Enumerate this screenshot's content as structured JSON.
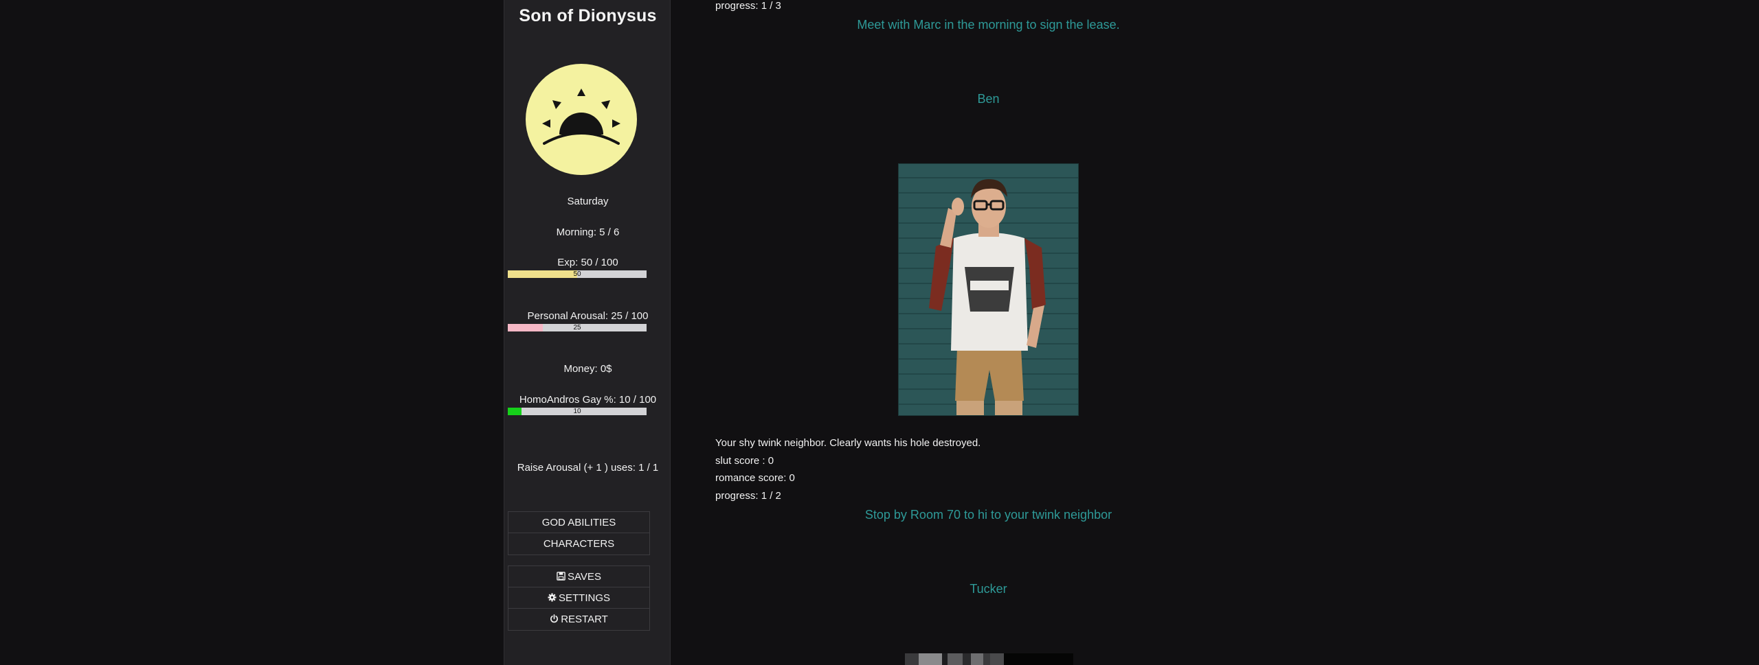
{
  "sidebar": {
    "title": "Son of Dionysus",
    "avatar_icon": "sunset-sun-icon",
    "day": "Saturday",
    "time_of_day": "Morning: 5 / 6",
    "exp": {
      "label": "Exp: 50 / 100",
      "value": 50,
      "max": 100,
      "bar_text": "50",
      "color": "#efe08c"
    },
    "arousal": {
      "label": "Personal Arousal: 25 / 100",
      "value": 25,
      "max": 100,
      "bar_text": "25",
      "color": "#f6b8c6"
    },
    "money": "Money: 0$",
    "gay": {
      "label": "HomoAndros Gay %: 10 / 100",
      "value": 10,
      "max": 100,
      "bar_text": "10",
      "color": "#16d11a"
    },
    "raise_arousal": "Raise Arousal (+ 1 ) uses: 1 / 1",
    "menu_primary": {
      "god_abilities": "GOD ABILITIES",
      "characters": "CHARACTERS"
    },
    "menu_system": {
      "saves": "SAVES",
      "settings": "SETTINGS",
      "restart": "RESTART"
    }
  },
  "passage": {
    "prev_progress": "progress: 1 / 3",
    "marc_task": "Meet with Marc in the morning to sign the lease.",
    "ben": {
      "name": "Ben",
      "description": "Your shy twink neighbor. Clearly wants his hole destroyed.",
      "slut_score": "slut score : 0",
      "romance_score": "romance score: 0",
      "progress": "progress: 1 / 2",
      "task": "Stop by Room 70 to hi to your twink neighbor"
    },
    "tucker": {
      "name": "Tucker"
    }
  },
  "colors": {
    "background": "#111012",
    "sidebar": "#222124",
    "link": "#2e9a98",
    "sun": "#f4f2a0"
  }
}
